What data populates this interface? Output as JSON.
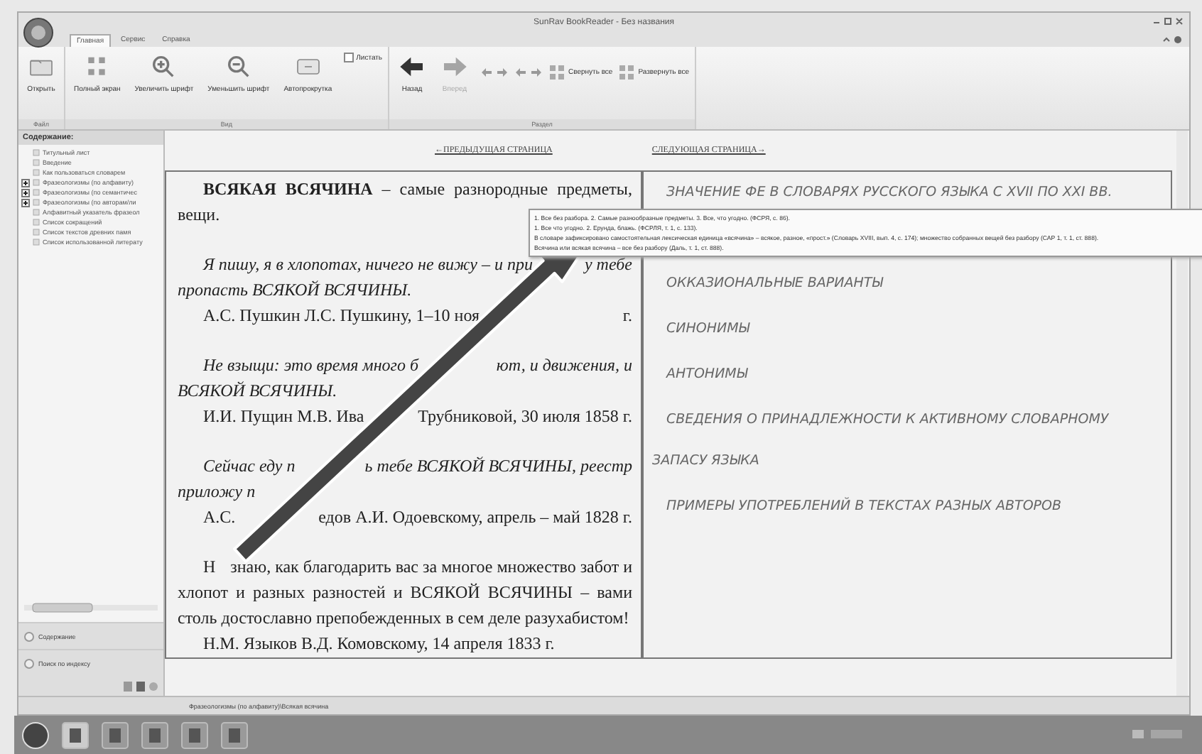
{
  "window": {
    "title": "SunRav BookReader - Без названия"
  },
  "ribbon_tabs": [
    {
      "label": "Главная",
      "selected": true
    },
    {
      "label": "Сервис",
      "selected": false
    },
    {
      "label": "Справка",
      "selected": false
    }
  ],
  "ribbon": {
    "groups": [
      {
        "label": "Файл",
        "buttons": [
          {
            "label": "Открыть",
            "disabled": false
          }
        ]
      },
      {
        "label": "Вид",
        "buttons": [
          {
            "label": "Полный экран",
            "disabled": false
          },
          {
            "label": "Увеличить шрифт",
            "disabled": false
          },
          {
            "label": "Уменьшить шрифт",
            "disabled": false
          },
          {
            "label": "Автопрокрутка",
            "disabled": false
          }
        ],
        "checkbox": {
          "label": "Листать",
          "checked": false
        }
      },
      {
        "label": "Раздел",
        "buttons": [
          {
            "label": "Назад",
            "disabled": false
          },
          {
            "label": "Вперед",
            "disabled": true
          }
        ],
        "small_buttons": [
          {
            "label": "Свернуть все"
          },
          {
            "label": "Развернуть все"
          }
        ]
      }
    ]
  },
  "sidebar": {
    "title": "Содержание:",
    "items": [
      {
        "label": "Титульный лист",
        "kind": "leaf",
        "expanded": false
      },
      {
        "label": "Введение",
        "kind": "leaf",
        "expanded": false
      },
      {
        "label": "Как пользоваться словарем",
        "kind": "leaf",
        "expanded": false
      },
      {
        "label": "Фразеологизмы (по алфавиту)",
        "kind": "group",
        "expanded": false
      },
      {
        "label": "Фразеологизмы (по семантичес",
        "kind": "group",
        "expanded": false
      },
      {
        "label": "Фразеологизмы (по авторам/ли",
        "kind": "group",
        "expanded": false
      },
      {
        "label": "Алфавитный указатель фразеол",
        "kind": "leaf",
        "expanded": false
      },
      {
        "label": "Список сокращений",
        "kind": "leaf",
        "expanded": false
      },
      {
        "label": "Список текстов древних памя",
        "kind": "leaf",
        "expanded": false
      },
      {
        "label": "Список использованной литерату",
        "kind": "leaf",
        "expanded": false
      }
    ],
    "nav_buttons": [
      "Содержание",
      "Поиск по индексу"
    ]
  },
  "page_links": [
    "←ПРЕДЫДУЩАЯ СТРАНИЦА",
    "СЛЕДУЮЩАЯ СТРАНИЦА→"
  ],
  "article": [
    {
      "kind": "definition",
      "lines": [
        [
          "**ВСЯКАЯ ВСЯЧИНА** – самые разнородные предметы,"
        ],
        [
          "вещи."
        ]
      ]
    },
    {
      "kind": "quote",
      "lines": [
        [
          "Я пишу, я в хлопотах, ничего не вижу – и при",
          "у тебе"
        ],
        [
          "пропасть ВСЯКОЙ ВСЯЧИНЫ."
        ]
      ]
    },
    {
      "kind": "source",
      "lines": [
        [
          "А.С. Пушкин Л.С. Пушкину, 1–10 ноя",
          "г."
        ]
      ]
    },
    {
      "kind": "quote",
      "lines": [
        [
          "Не взыщи: это время много б",
          "ют, и движения, и"
        ],
        [
          "ВСЯКОЙ ВСЯЧИНЫ."
        ]
      ]
    },
    {
      "kind": "source",
      "lines": [
        [
          "И.И. Пущин М.В. Ива",
          "Трубниковой, 30 июля 1858 г."
        ]
      ]
    },
    {
      "kind": "quote",
      "lines": [
        [
          "Сейчас еду п",
          "ь тебе ВСЯКОЙ ВСЯЧИНЫ, реестр"
        ],
        [
          "приложу п"
        ]
      ]
    },
    {
      "kind": "source",
      "lines": [
        [
          "А.С.",
          "едов А.И. Одоевскому, апрель – май 1828 г."
        ]
      ]
    },
    {
      "kind": "text",
      "lines": [
        [
          "Н",
          "знаю, как благодарить вас за многое множество забот и"
        ],
        [
          "хлопот и разных разностей и ВСЯКОЙ ВСЯЧИНЫ – вами"
        ],
        [
          "столь достославно препобежденных в сем деле разухабистом!"
        ]
      ]
    },
    {
      "kind": "source",
      "lines": [
        [
          "Н.М. Языков В.Д. Комовскому, 14 апреля 1833 г."
        ]
      ]
    }
  ],
  "sections": [
    "ЗНАЧЕНИЕ ФЕ В СЛОВАРЯХ  РУССКОГО ЯЗЫКА С XVII ПО XXI ВВ.",
    "ОККАЗИОНАЛЬНЫЕ ВАРИАНТЫ",
    "СИНОНИМЫ",
    "АНТОНИМЫ",
    "СВЕДЕНИЯ О ПРИНАДЛЕЖНОСТИ К АКТИВНОМУ СЛОВАРНОМУ ЗАПАСУ ЯЗЫКА",
    "ПРИМЕРЫ УПОТРЕБЛЕНИЙ В ТЕКСТАХ РАЗНЫХ АВТОРОВ"
  ],
  "tooltip": {
    "lines": [
      "1. Все без разбора. 2. Самые разнообразные предметы. 3. Все, что угодно. (ФСРЯ, с. 86).",
      "1. Все что угодно. 2. Ерунда, блажь. (ФСРЛЯ, т. 1, с. 133).",
      "В словаре зафиксировано самостоятельная лексическая единица «всячина» – всякое, разное, «прост.» (Словарь XVIII, вып. 4, с. 174); множество собранных вещей без разбору (САР 1, т. 1, ст. 888).",
      "Всячина или всякая всячина – все без разбору (Даль, т. 1, ст. 888)."
    ]
  },
  "status_bar": {
    "path": "Фразеологизмы (по алфавиту)\\Всякая всячина"
  }
}
